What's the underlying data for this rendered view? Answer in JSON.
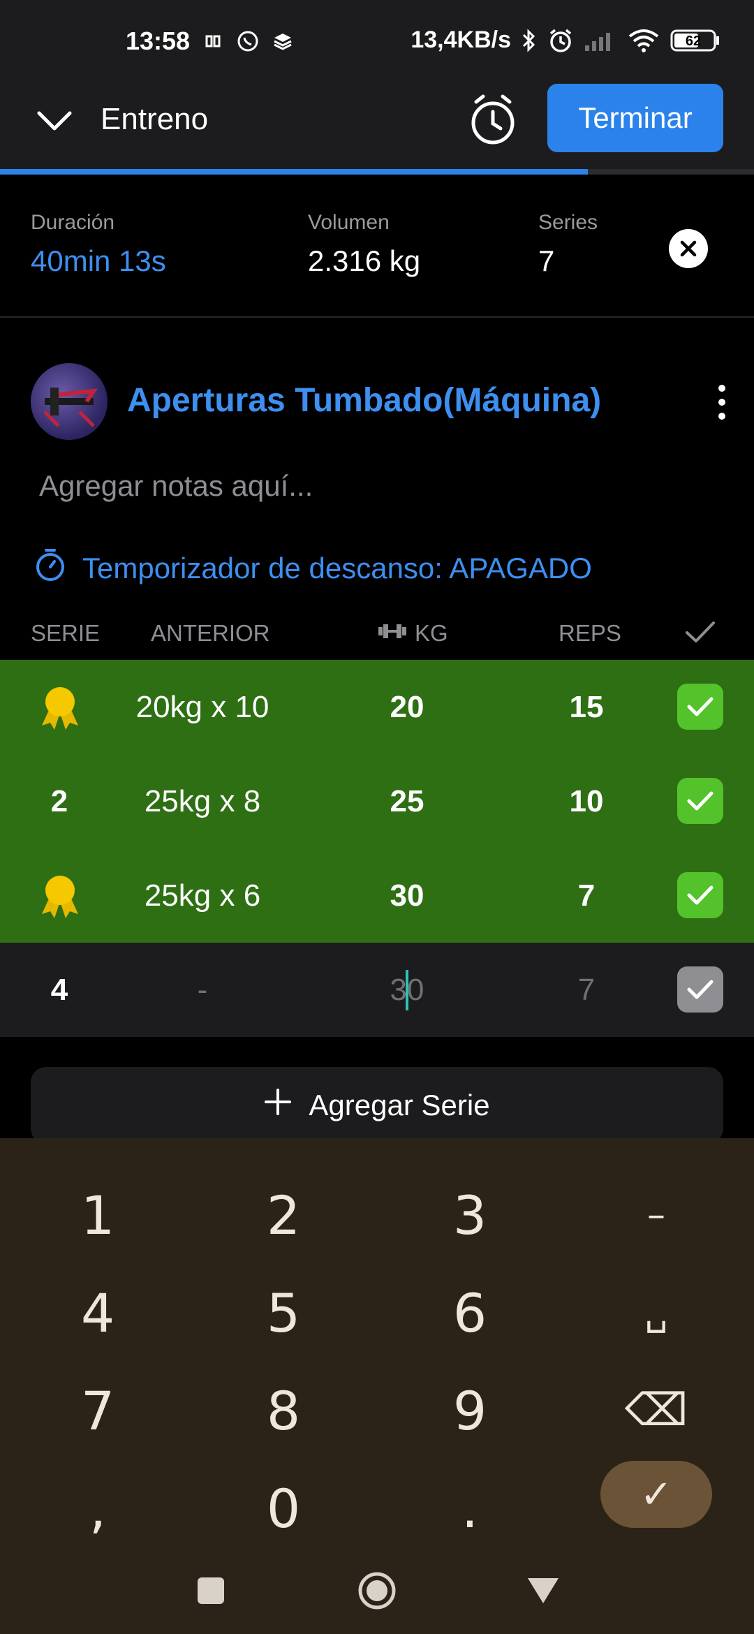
{
  "status_bar": {
    "time": "13:58",
    "network_speed": "13,4KB/s",
    "battery": "62",
    "icons": [
      "link-icon",
      "whatsapp-icon",
      "layers-icon",
      "bluetooth-icon",
      "alarm-icon",
      "signal-icon",
      "wifi-icon",
      "battery-icon"
    ]
  },
  "app_bar": {
    "title": "Entreno",
    "finish_label": "Terminar",
    "progress_percent": 78
  },
  "stats": {
    "duration_label": "Duración",
    "duration_value": "40min 13s",
    "volume_label": "Volumen",
    "volume_value": "2.316 kg",
    "sets_label": "Series",
    "sets_value": "7"
  },
  "exercise": {
    "name": "Aperturas Tumbado(Máquina)",
    "notes_placeholder": "Agregar notas aquí...",
    "rest_timer": "Temporizador de descanso: APAGADO"
  },
  "table": {
    "headers": {
      "set": "SERIE",
      "previous": "ANTERIOR",
      "kg": "KG",
      "reps": "REPS"
    },
    "rows": [
      {
        "set": "",
        "set_icon": "medal-icon",
        "previous": "20kg x 10",
        "kg": "20",
        "reps": "15",
        "completed": true
      },
      {
        "set": "2",
        "previous": "25kg x 8",
        "kg": "25",
        "reps": "10",
        "completed": true
      },
      {
        "set": "",
        "set_icon": "medal-icon",
        "previous": "25kg x 6",
        "kg": "30",
        "reps": "7",
        "completed": true
      },
      {
        "set": "4",
        "previous": "-",
        "kg_a": "3",
        "kg_b": "0",
        "reps": "7",
        "completed": false
      }
    ]
  },
  "add_set_label": "Agregar Serie",
  "keyboard": {
    "keys": [
      "1",
      "2",
      "3",
      "–",
      "4",
      "5",
      "6",
      "␣",
      "7",
      "8",
      "9",
      "⌫",
      ",",
      "0",
      ".",
      "✓"
    ]
  },
  "colors": {
    "accent": "#2a82ea",
    "completed_row": "#2e6f14",
    "check_on": "#54c22a",
    "keyboard_bg": "#2b2218"
  }
}
